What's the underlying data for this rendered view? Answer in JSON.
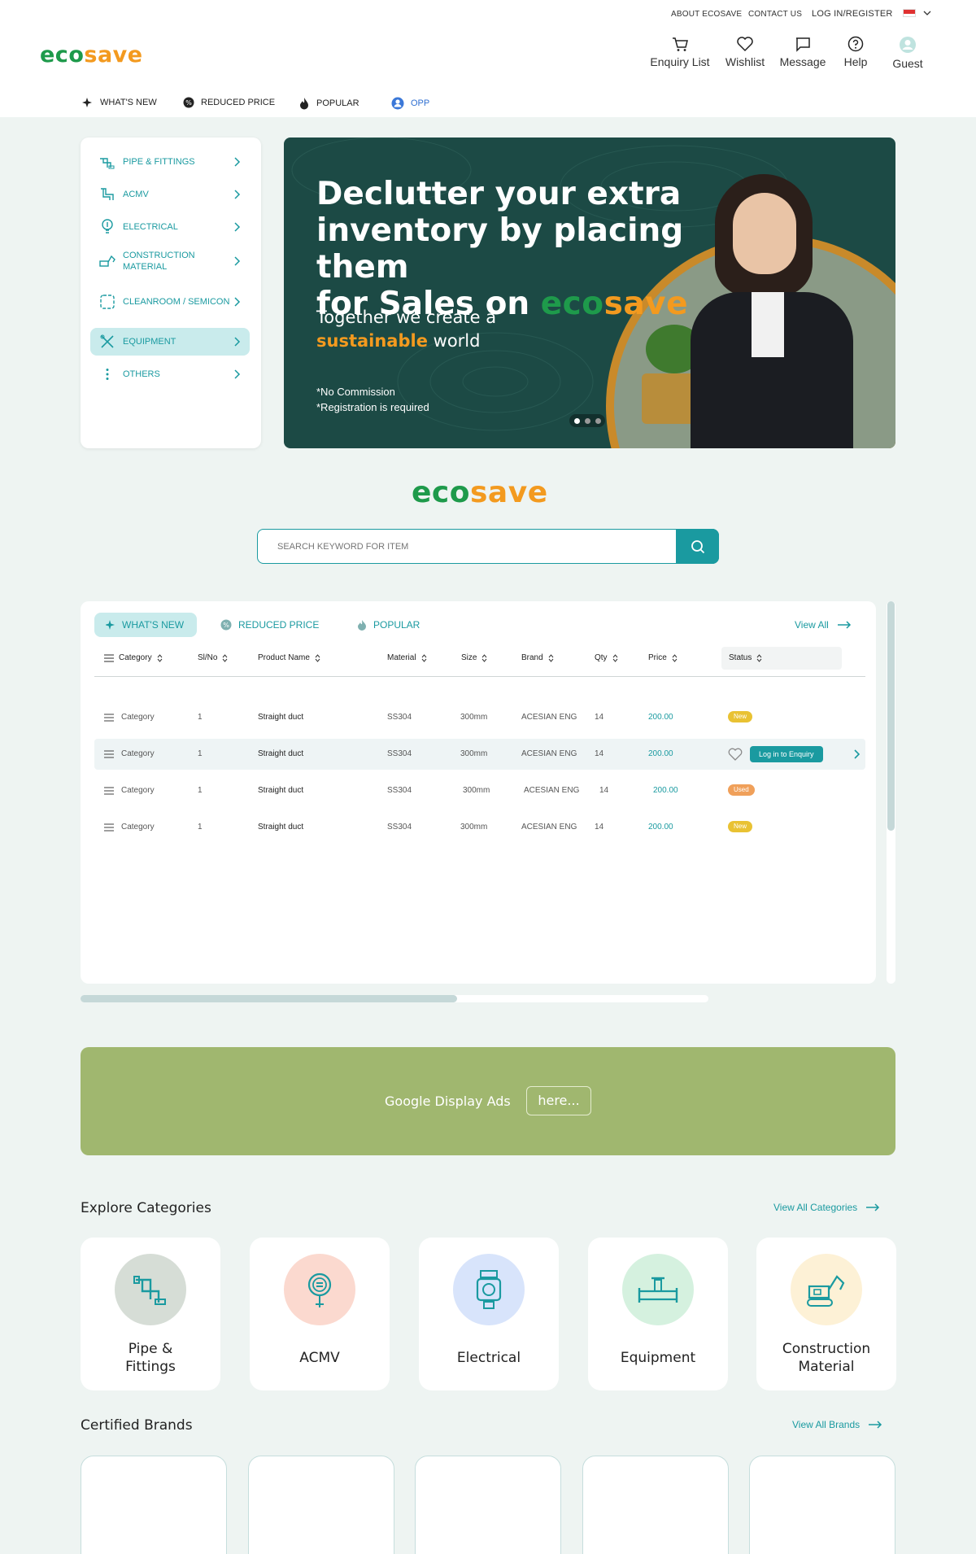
{
  "header": {
    "top_links": [
      "ABOUT ECOSAVE",
      "CONTACT US",
      "LOG IN/REGISTER"
    ],
    "logo": {
      "eco": "eco",
      "save": "save"
    },
    "icons": [
      {
        "label": "Enquiry List",
        "icon": "cart-icon"
      },
      {
        "label": "Wishlist",
        "icon": "heart-icon"
      },
      {
        "label": "Message",
        "icon": "message-icon"
      },
      {
        "label": "Help",
        "icon": "help-icon"
      },
      {
        "label": "Guest",
        "icon": "user-avatar-icon"
      }
    ]
  },
  "nav_tabs": [
    {
      "label": "WHAT'S NEW",
      "icon": "sparkle-icon"
    },
    {
      "label": "REDUCED PRICE",
      "icon": "discount-badge-icon"
    },
    {
      "label": "POPULAR",
      "icon": "flame-icon"
    },
    {
      "label": "OPP",
      "icon": "user-circle-icon"
    }
  ],
  "sidebar": {
    "items": [
      {
        "label": "PIPE & FITTINGS",
        "icon": "pipe-icon"
      },
      {
        "label": "ACMV",
        "icon": "duct-icon"
      },
      {
        "label": "ELECTRICAL",
        "icon": "bulb-icon"
      },
      {
        "label": "CONSTRUCTION MATERIAL",
        "icon": "excavator-icon"
      },
      {
        "label": "CLEANROOM / SEMICON",
        "icon": "cleanroom-icon"
      },
      {
        "label": "EQUIPMENT",
        "icon": "tools-icon"
      },
      {
        "label": "OTHERS",
        "icon": "more-vertical-icon"
      }
    ],
    "active_index": 5
  },
  "banner": {
    "line1": "Declutter your extra",
    "line2": "inventory by placing them",
    "line3": "for Sales on",
    "logo_eco": "eco",
    "logo_save": "save",
    "sub1": "Together we create a",
    "sub2a": "sustainable",
    "sub2b": "world",
    "note1": "*No Commission",
    "note2": "*Registration is required",
    "dots": 3,
    "active_dot": 0
  },
  "search": {
    "placeholder": "SEARCH KEYWORD FOR ITEM"
  },
  "table": {
    "tabs": [
      "WHAT'S NEW",
      "REDUCED PRICE",
      "POPULAR"
    ],
    "active_tab": 0,
    "view_all": "View All",
    "columns": [
      "Category",
      "Sl/No",
      "Product Name",
      "Material",
      "Size",
      "Brand",
      "Qty",
      "Price",
      "Status"
    ],
    "rows": [
      {
        "category": "Category",
        "slno": "1",
        "product": "Straight duct",
        "material": "SS304",
        "size": "300mm",
        "brand": "ACESIAN ENG",
        "qty": "14",
        "price": "200.00",
        "status": "New"
      },
      {
        "category": "Category",
        "slno": "1",
        "product": "Straight duct",
        "material": "SS304",
        "size": "300mm",
        "brand": "ACESIAN ENG",
        "qty": "14",
        "price": "200.00",
        "status": "",
        "action": "Log in to Enquiry"
      },
      {
        "category": "Category",
        "slno": "1",
        "product": "Straight duct",
        "material": "SS304",
        "size": "300mm",
        "brand": "ACESIAN ENG",
        "qty": "14",
        "price": "200.00",
        "status": "Used"
      },
      {
        "category": "Category",
        "slno": "1",
        "product": "Straight duct",
        "material": "SS304",
        "size": "300mm",
        "brand": "ACESIAN ENG",
        "qty": "14",
        "price": "200.00",
        "status": "New"
      }
    ],
    "colors": {
      "new": "#e9c233",
      "used": "#f0a05a",
      "accent": "#1a9aa0"
    }
  },
  "ads": {
    "text": "Google Display Ads",
    "button": "here..."
  },
  "categories": {
    "title": "Explore Categories",
    "view_all": "View All Categories",
    "items": [
      {
        "label": "Pipe & Fittings",
        "icon": "pipe-icon",
        "bg": "#d6ddd6"
      },
      {
        "label": "ACMV",
        "icon": "gauge-icon",
        "bg": "#fbd9cf"
      },
      {
        "label": "Electrical",
        "icon": "plug-icon",
        "bg": "#d8e4fb"
      },
      {
        "label": "Equipment",
        "icon": "valve-pipe-icon",
        "bg": "#d5f1df"
      },
      {
        "label": "Construction Material",
        "icon": "excavator-icon",
        "bg": "#fdf1d6"
      }
    ]
  },
  "brands": {
    "title": "Certified Brands",
    "view_all": "View All Brands",
    "count": 5
  }
}
